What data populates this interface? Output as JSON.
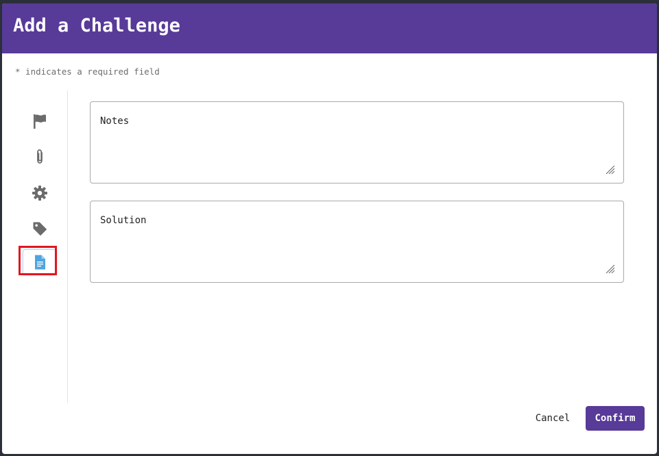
{
  "modal": {
    "title": "Add a Challenge",
    "required_note": "* indicates a required field"
  },
  "sidebar": {
    "items": [
      {
        "icon": "flag-icon",
        "active": false
      },
      {
        "icon": "paperclip-icon",
        "active": false
      },
      {
        "icon": "gear-icon",
        "active": false
      },
      {
        "icon": "tag-icon",
        "active": false
      },
      {
        "icon": "document-icon",
        "active": true
      }
    ]
  },
  "fields": {
    "notes": {
      "placeholder": "Notes",
      "value": ""
    },
    "solution": {
      "placeholder": "Solution",
      "value": ""
    }
  },
  "footer": {
    "cancel_label": "Cancel",
    "confirm_label": "Confirm"
  },
  "colors": {
    "header": "#583a98",
    "icon": "#6b6b6b",
    "active_icon": "#4ea5de",
    "highlight": "#e0161f"
  }
}
